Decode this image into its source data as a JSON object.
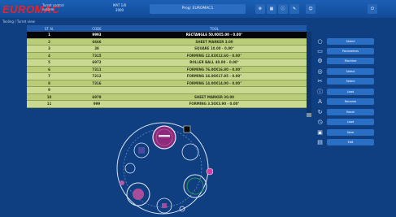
{
  "app": {
    "logo": "EUROMAC",
    "logo_sub": "Turret control system"
  },
  "top": {
    "info_line1": "MAT 1/8",
    "info_line2": "3000",
    "program": "Prog: EUROMAC1"
  },
  "top_icons": [
    "gear-icon",
    "grid-icon",
    "info-icon",
    "tool-icon",
    "user-icon",
    "power-icon"
  ],
  "breadcrumb": "Tooling / Turret view",
  "table": {
    "headers": [
      "ST. N.",
      "CODE",
      "TOOL"
    ],
    "rows": [
      {
        "station": "1",
        "code": "9993",
        "tool": "RECTANGLE 50.00X5.00 - 0.00°",
        "style": "sel"
      },
      {
        "station": "2",
        "code": "6666",
        "tool": "SHEET MARKER 3.00",
        "style": "n"
      },
      {
        "station": "3",
        "code": "38",
        "tool": "SQUARE 10.00 - 0.00°",
        "style": "alt"
      },
      {
        "station": "4",
        "code": "7315",
        "tool": "FORMING 12.83X12.60 - 0.00°",
        "style": "n"
      },
      {
        "station": "5",
        "code": "6972",
        "tool": "ROLLER BALL 40.00 - 0.00°",
        "style": "alt"
      },
      {
        "station": "6",
        "code": "7311",
        "tool": "FORMING 76.00X16.80 - 0.00°",
        "style": "n"
      },
      {
        "station": "7",
        "code": "7212",
        "tool": "FORMING 24.00X17.85 - 0.00°",
        "style": "alt"
      },
      {
        "station": "8",
        "code": "7316",
        "tool": "FORMING 14.00X14.00 - 0.00°",
        "style": "n"
      },
      {
        "station": "9",
        "code": "",
        "tool": "",
        "style": "alt"
      },
      {
        "station": "10",
        "code": "6979",
        "tool": "SHEET MARKER 30.00",
        "style": "n"
      },
      {
        "station": "11",
        "code": "999",
        "tool": "FORMING 3.50X3.90 - 0.00°",
        "style": "alt"
      }
    ]
  },
  "side_buttons": [
    {
      "icon": "circle-icon",
      "label": "Select"
    },
    {
      "icon": "rect-icon",
      "label": "Parameters"
    },
    {
      "icon": "gear-icon",
      "label": "Machine"
    },
    {
      "icon": "target-icon",
      "label": "Select"
    },
    {
      "icon": "cut-icon",
      "label": "Select"
    },
    {
      "icon": "info-icon",
      "label": "Load"
    },
    {
      "icon": "a-icon",
      "label": "Rename"
    },
    {
      "icon": "refresh-icon",
      "label": "Reset"
    },
    {
      "icon": "clock-icon",
      "label": "Load"
    },
    {
      "icon": "save-icon",
      "label": "Save"
    },
    {
      "icon": "doc-icon",
      "label": "Edit"
    }
  ]
}
